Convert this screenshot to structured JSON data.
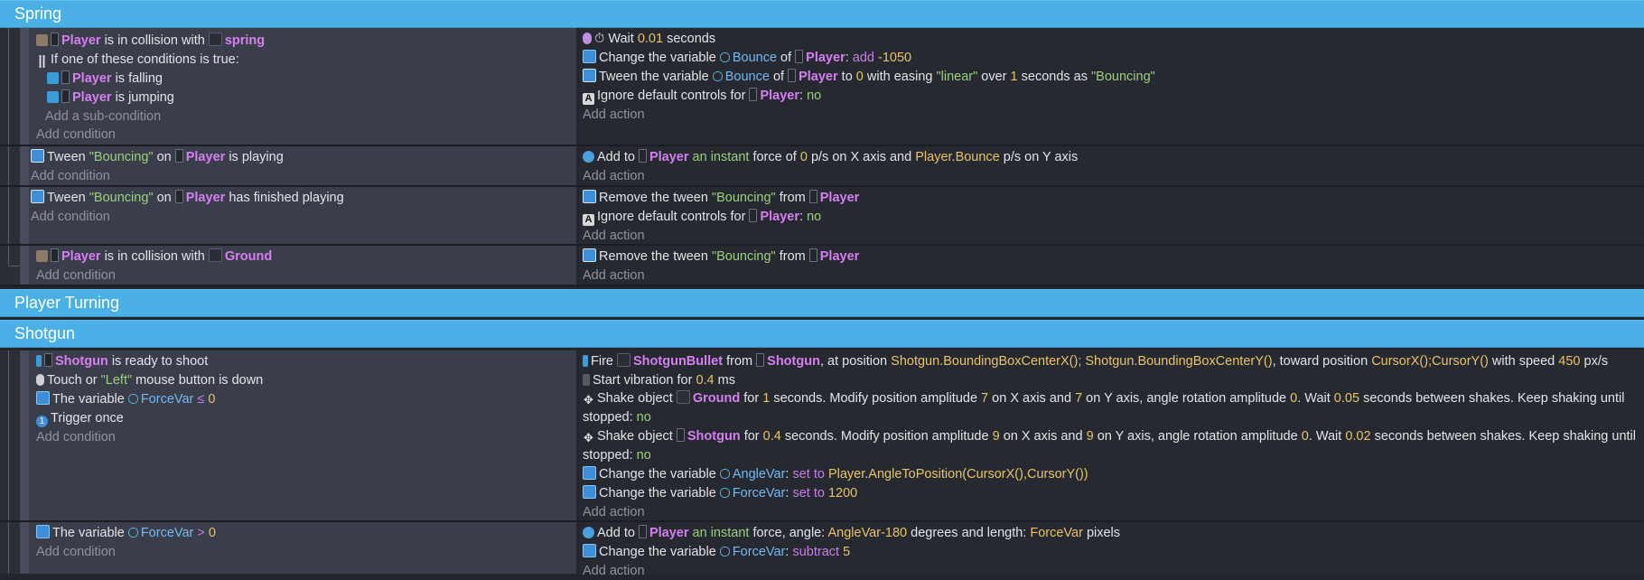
{
  "groups": {
    "spring": "Spring",
    "player_turning": "Player Turning",
    "shotgun": "Shotgun"
  },
  "common": {
    "add_condition": "Add condition",
    "add_action": "Add action",
    "add_sub_condition": "Add a sub-condition"
  },
  "objects": {
    "player": "Player",
    "spring": "spring",
    "ground": "Ground",
    "shotgun": "Shotgun",
    "shotgun_bullet": "ShotgunBullet"
  },
  "spring_events": {
    "e1": {
      "c1_mid": "is in collision with",
      "c2": "If one of these conditions is true:",
      "c3_mid": "is falling",
      "c4_mid": "is jumping",
      "a1_pre": "Wait",
      "a1_num": "0.01",
      "a1_post": "seconds",
      "a2_pre": "Change the variable",
      "a2_var": "Bounce",
      "a2_of": "of",
      "a2_colon": ":",
      "a2_op": "add",
      "a2_val": "-1050",
      "a3_pre": "Tween the variable",
      "a3_var": "Bounce",
      "a3_of": "of",
      "a3_to": "to",
      "a3_num": "0",
      "a3_with": "with easing",
      "a3_easing": "\"linear\"",
      "a3_over": "over",
      "a3_secs": "1",
      "a3_as": "seconds as",
      "a3_name": "\"Bouncing\"",
      "a4_pre": "Ignore default controls for",
      "a4_colon": ":",
      "a4_val": "no"
    },
    "e2": {
      "c1_pre": "Tween",
      "c1_name": "\"Bouncing\"",
      "c1_on": "on",
      "c1_post": "is playing",
      "a1_pre": "Add to",
      "a1_mid": "an instant",
      "a1_force": "force of",
      "a1_x": "0",
      "a1_xaxis": "p/s on X axis and",
      "a1_y": "Player.Bounce",
      "a1_yaxis": "p/s on Y axis"
    },
    "e3": {
      "c1_pre": "Tween",
      "c1_name": "\"Bouncing\"",
      "c1_on": "on",
      "c1_post": "has finished playing",
      "a1_pre": "Remove the tween",
      "a1_name": "\"Bouncing\"",
      "a1_from": "from",
      "a2_pre": "Ignore default controls for",
      "a2_colon": ":",
      "a2_val": "no"
    },
    "e4": {
      "c1_mid": "is in collision with",
      "a1_pre": "Remove the tween",
      "a1_name": "\"Bouncing\"",
      "a1_from": "from"
    }
  },
  "shotgun_events": {
    "e1": {
      "c1_post": "is ready to shoot",
      "c2_pre": "Touch or",
      "c2_btn": "\"Left\"",
      "c2_post": "mouse button is down",
      "c3_pre": "The variable",
      "c3_var": "ForceVar",
      "c3_op": "≤",
      "c3_val": "0",
      "c4": "Trigger once",
      "a1_pre": "Fire",
      "a1_from": "from",
      "a1_pos": ", at position",
      "a1_x": "Shotgun.BoundingBoxCenterX();",
      "a1_y": "Shotgun.BoundingBoxCenterY()",
      "a1_toward": ", toward position",
      "a1_cursor": "CursorX();CursorY()",
      "a1_speed": "with speed",
      "a1_speed_val": "450",
      "a1_unit": "px/s",
      "a2_pre": "Start vibration for",
      "a2_val": "0.4",
      "a2_unit": "ms",
      "a3_pre": "Shake object",
      "a3_for": "for",
      "a3_secs": "1",
      "a3_mod": "seconds. Modify position amplitude",
      "a3_x": "7",
      "a3_onx": "on X axis and",
      "a3_y": "7",
      "a3_ony": "on Y axis, angle rotation amplitude",
      "a3_ang": "0",
      "a3_wait": ". Wait",
      "a3_wait_val": "0.05",
      "a3_between": "seconds between shakes. Keep shaking until stopped:",
      "a3_stop": "no",
      "a4_pre": "Shake object",
      "a4_for": "for",
      "a4_secs": "0.4",
      "a4_mod": "seconds. Modify position amplitude",
      "a4_x": "9",
      "a4_onx": "on X axis and",
      "a4_y": "9",
      "a4_ony": "on Y axis, angle rotation amplitude",
      "a4_ang": "0",
      "a4_wait": ". Wait",
      "a4_wait_val": "0.02",
      "a4_between": "seconds between shakes. Keep shaking until stopped:",
      "a4_stop": "no",
      "a5_pre": "Change the variable",
      "a5_var": "AngleVar",
      "a5_colon": ":",
      "a5_op": "set to",
      "a5_val": "Player.AngleToPosition(CursorX(),CursorY())",
      "a6_pre": "Change the variable",
      "a6_var": "ForceVar",
      "a6_colon": ":",
      "a6_op": "set to",
      "a6_val": "1200"
    },
    "e2": {
      "c1_pre": "The variable",
      "c1_var": "ForceVar",
      "c1_op": ">",
      "c1_val": "0",
      "a1_pre": "Add to",
      "a1_mid": "an instant",
      "a1_force": "force, angle:",
      "a1_angle": "AngleVar-180",
      "a1_deg": "degrees and length:",
      "a1_len": "ForceVar",
      "a1_unit": "pixels",
      "a2_pre": "Change the variable",
      "a2_var": "ForceVar",
      "a2_colon": ":",
      "a2_op": "subtract",
      "a2_val": "5"
    }
  }
}
